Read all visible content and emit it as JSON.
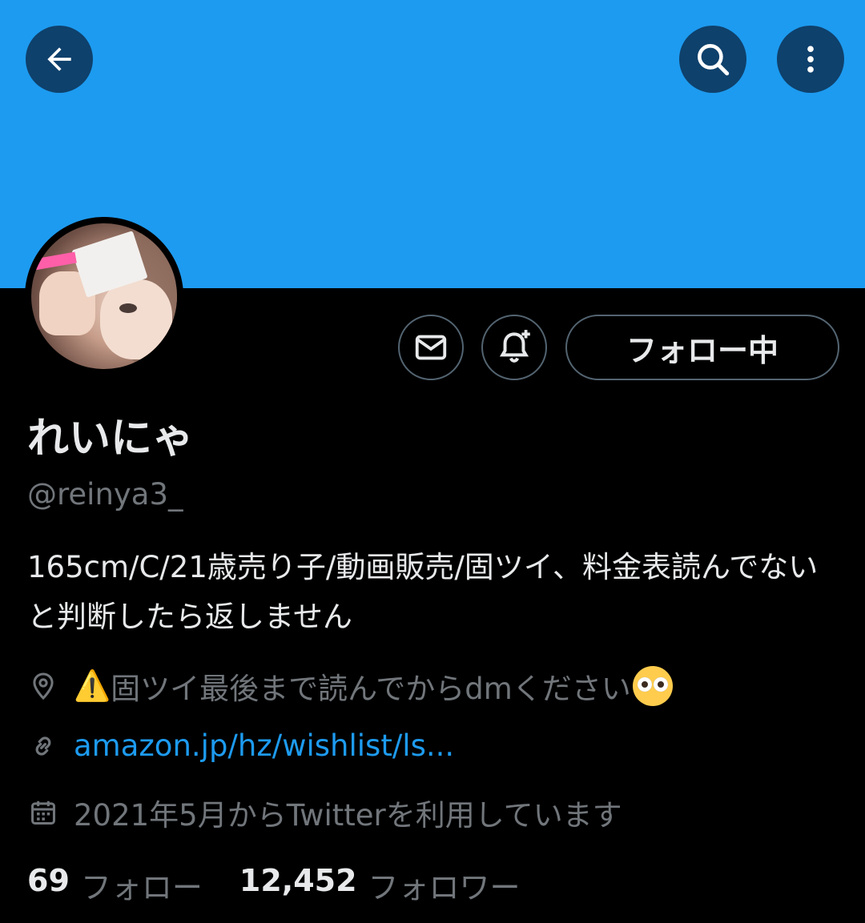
{
  "header": {
    "banner_color": "#1d9bf0",
    "back_icon": "arrow-left-icon",
    "search_icon": "search-icon",
    "more_icon": "more-vertical-icon"
  },
  "profile": {
    "display_name": "れいにゃ",
    "handle": "@reinya3_",
    "bio": "165cm/C/21歳売り子/動画販売/固ツイ、料金表読んでないと判断したら返しません",
    "location_warning": "⚠️",
    "location_text": "固ツイ最後まで読んでからdmください",
    "location_emoji": "pleading-face",
    "link": "amazon.jp/hz/wishlist/ls...",
    "joined": "2021年5月からTwitterを利用しています"
  },
  "actions": {
    "message_icon": "mail-icon",
    "notify_icon": "bell-plus-icon",
    "follow_label": "フォロー中"
  },
  "stats": {
    "following_count": "69",
    "following_label": "フォロー",
    "followers_count": "12,452",
    "followers_label": "フォロワー"
  },
  "colors": {
    "background": "#000000",
    "primary_text": "#e7e9ea",
    "secondary_text": "#71767b",
    "link": "#1d9bf0"
  }
}
